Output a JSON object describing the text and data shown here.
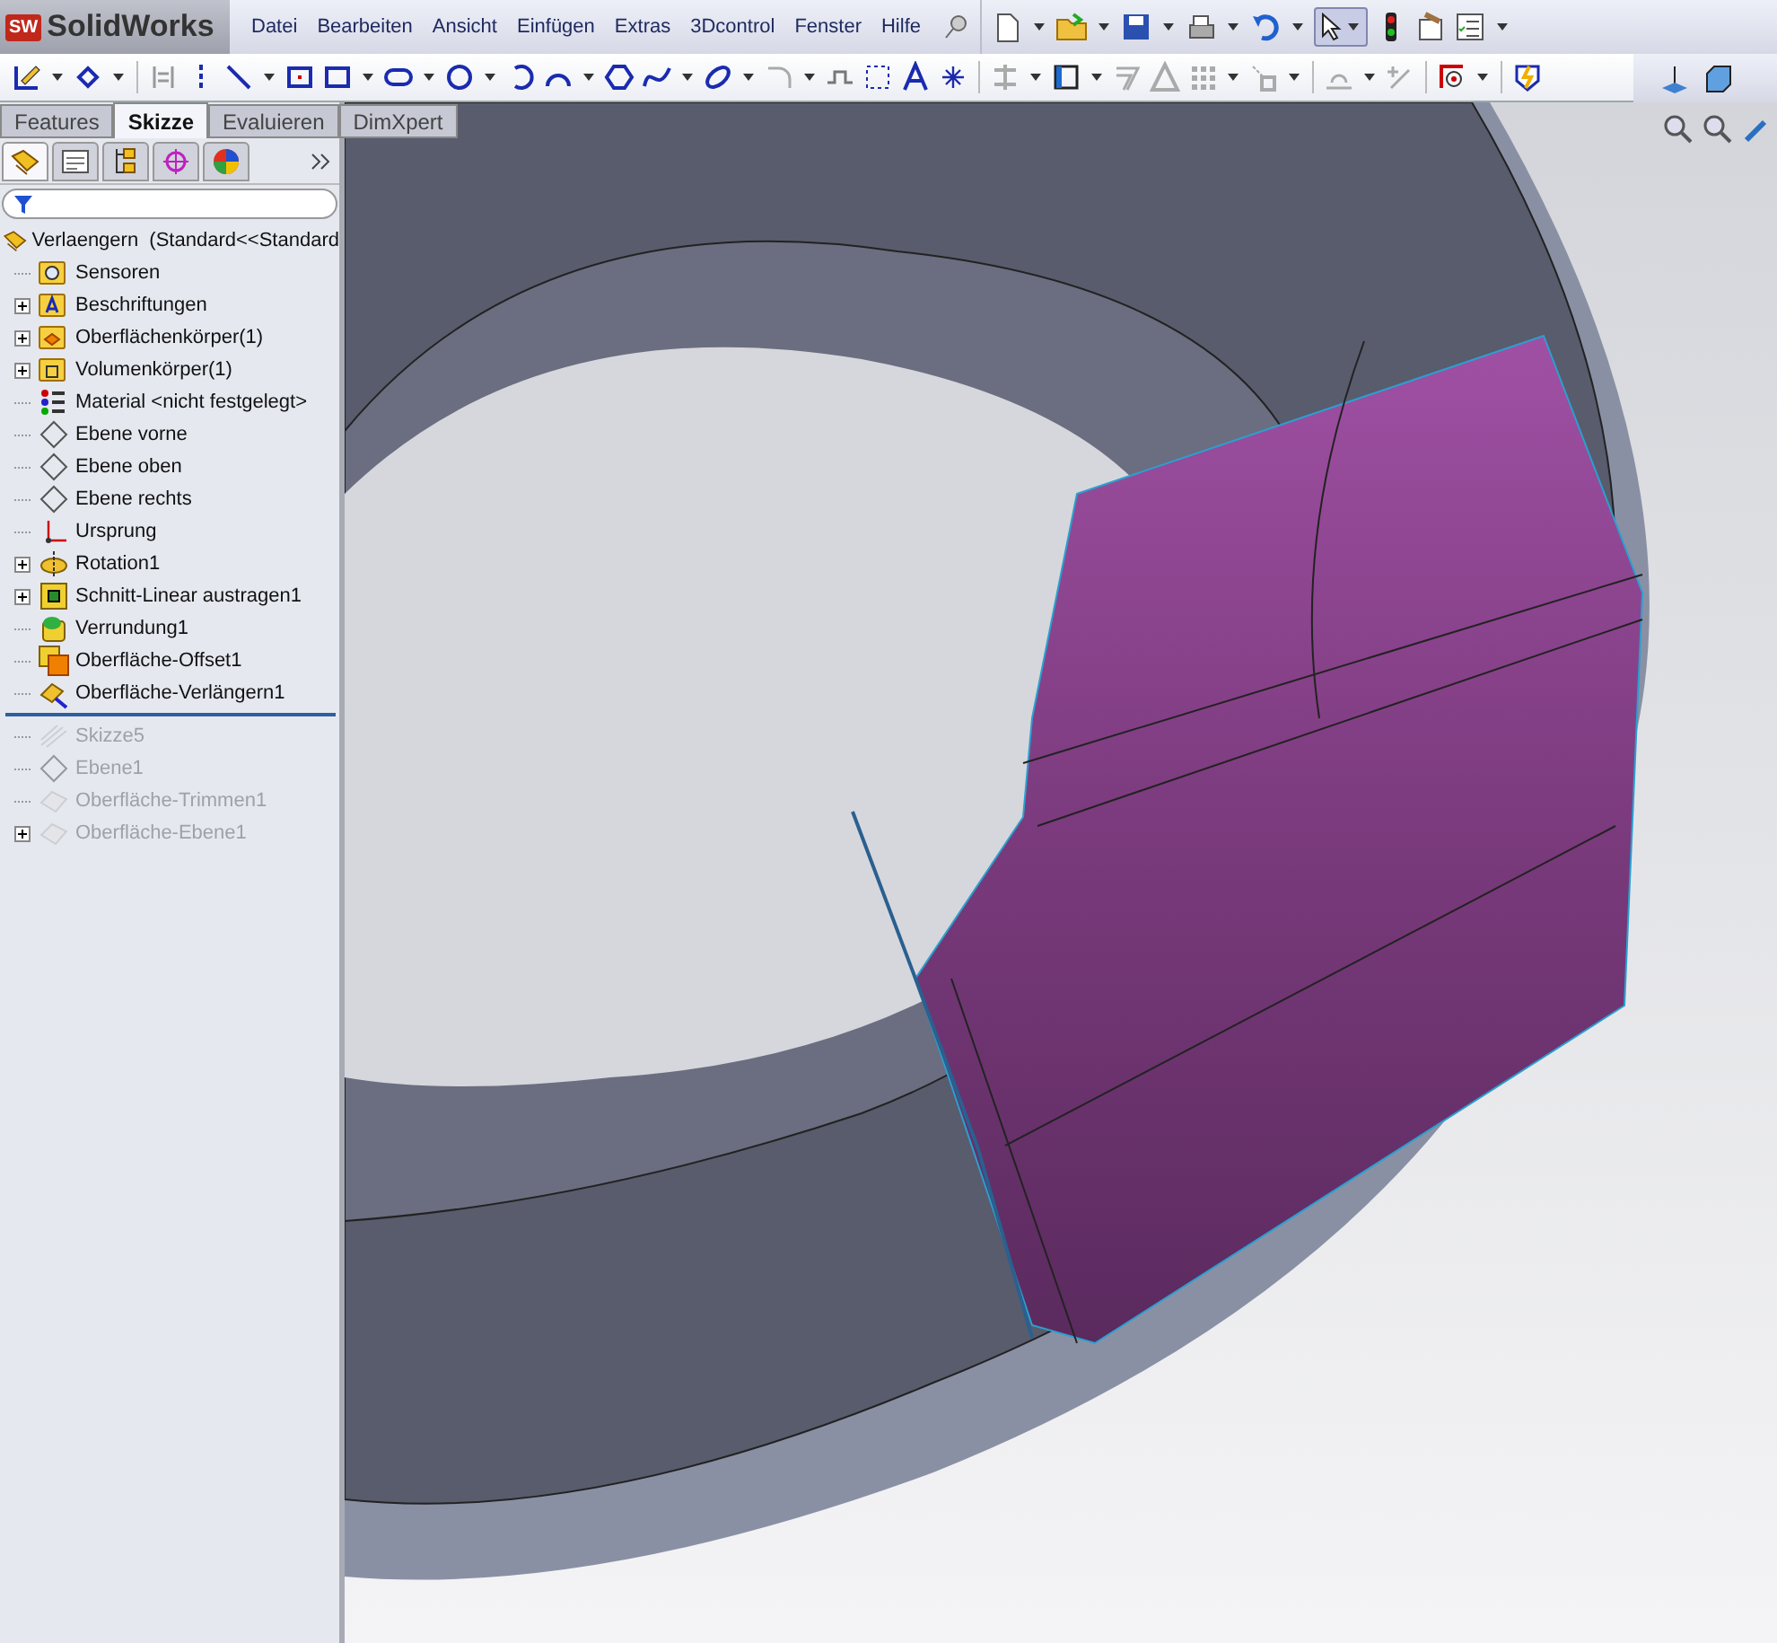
{
  "app": {
    "logo_badge": "SW",
    "logo_text": "SolidWorks"
  },
  "menu": [
    "Datei",
    "Bearbeiten",
    "Ansicht",
    "Einfügen",
    "Extras",
    "3Dcontrol",
    "Fenster",
    "Hilfe"
  ],
  "tabs": [
    {
      "label": "Features",
      "selected": false
    },
    {
      "label": "Skizze",
      "selected": true
    },
    {
      "label": "Evaluieren",
      "selected": false
    },
    {
      "label": "DimXpert",
      "selected": false
    }
  ],
  "panel_tabs": [
    {
      "kind": "feature-tree",
      "selected": true
    },
    {
      "kind": "properties",
      "selected": false
    },
    {
      "kind": "configurations",
      "selected": false
    },
    {
      "kind": "dimxpert",
      "selected": false
    },
    {
      "kind": "display",
      "selected": false
    }
  ],
  "tree": {
    "root": "Verlaengern  (Standard<<Standard",
    "items": [
      {
        "label": "Sensoren",
        "kind": "sensor-folder",
        "expandable": false,
        "disabled": false
      },
      {
        "label": "Beschriftungen",
        "kind": "annotation-folder",
        "expandable": true,
        "disabled": false
      },
      {
        "label": "Oberflächenkörper(1)",
        "kind": "surface-folder",
        "expandable": true,
        "disabled": false
      },
      {
        "label": "Volumenkörper(1)",
        "kind": "solid-folder",
        "expandable": true,
        "disabled": false
      },
      {
        "label": "Material <nicht festgelegt>",
        "kind": "material",
        "expandable": false,
        "disabled": false
      },
      {
        "label": "Ebene vorne",
        "kind": "plane",
        "expandable": false,
        "disabled": false
      },
      {
        "label": "Ebene oben",
        "kind": "plane",
        "expandable": false,
        "disabled": false
      },
      {
        "label": "Ebene rechts",
        "kind": "plane",
        "expandable": false,
        "disabled": false
      },
      {
        "label": "Ursprung",
        "kind": "origin",
        "expandable": false,
        "disabled": false
      },
      {
        "label": "Rotation1",
        "kind": "revolve",
        "expandable": true,
        "disabled": false
      },
      {
        "label": "Schnitt-Linear austragen1",
        "kind": "cut",
        "expandable": true,
        "disabled": false
      },
      {
        "label": "Verrundung1",
        "kind": "fillet",
        "expandable": false,
        "disabled": false
      },
      {
        "label": "Oberfläche-Offset1",
        "kind": "offset",
        "expandable": false,
        "disabled": false
      },
      {
        "label": "Oberfläche-Verlängern1",
        "kind": "extend",
        "expandable": false,
        "disabled": false
      },
      {
        "kind": "rollback"
      },
      {
        "label": "Skizze5",
        "kind": "sketch",
        "expandable": false,
        "disabled": true
      },
      {
        "label": "Ebene1",
        "kind": "plane",
        "expandable": false,
        "disabled": true
      },
      {
        "label": "Oberfläche-Trimmen1",
        "kind": "surface",
        "expandable": false,
        "disabled": true
      },
      {
        "label": "Oberfläche-Ebene1",
        "kind": "surface",
        "expandable": true,
        "disabled": true
      }
    ]
  }
}
